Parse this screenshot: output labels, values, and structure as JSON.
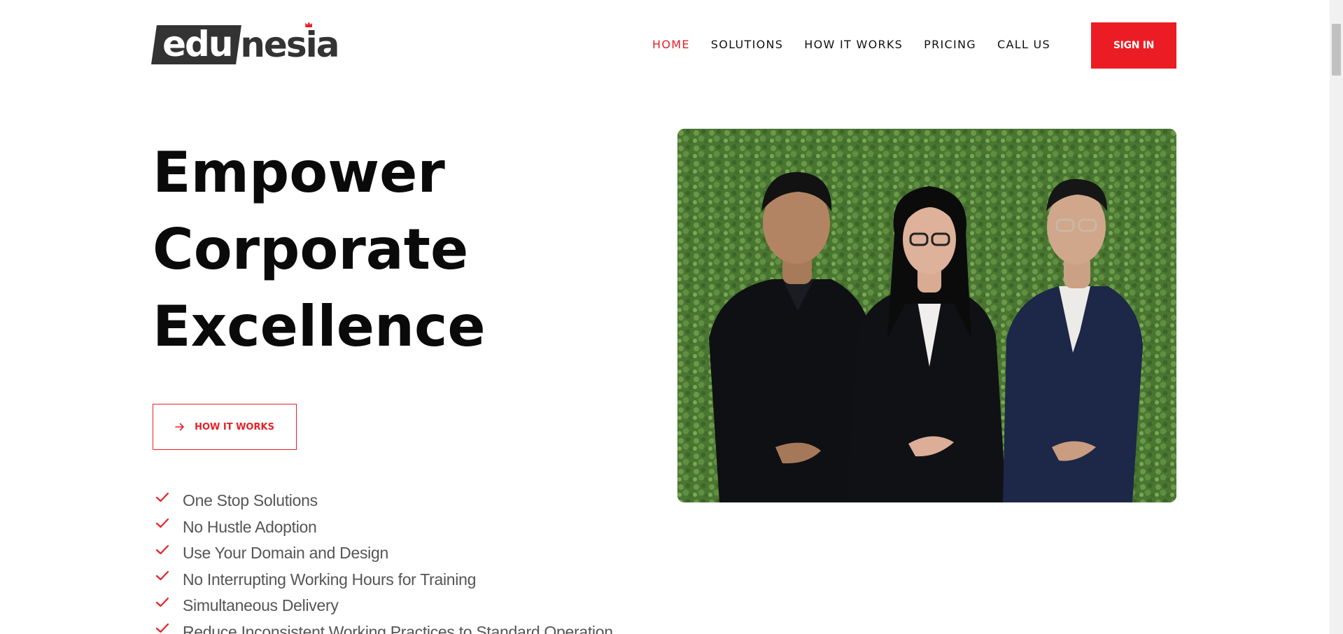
{
  "brand": {
    "logo_boxed": "edu",
    "logo_rest": "nesia",
    "accent_color": "#e62129"
  },
  "nav": {
    "items": [
      {
        "label": "HOME",
        "active": true
      },
      {
        "label": "SOLUTIONS",
        "active": false
      },
      {
        "label": "HOW IT WORKS",
        "active": false
      },
      {
        "label": "PRICING",
        "active": false
      },
      {
        "label": "CALL US",
        "active": false
      }
    ],
    "sign_in_label": "SIGN IN"
  },
  "hero": {
    "title_lines": [
      "Empower",
      "Corporate",
      "Excellence"
    ],
    "button_label": "HOW IT WORKS",
    "button_icon": "arrow-right-icon",
    "features": [
      "One Stop Solutions",
      "No Hustle Adoption",
      "Use Your Domain and Design",
      "No Interrupting Working Hours for Training",
      "Simultaneous Delivery",
      "Reduce Inconsistent Working Practices to Standard Operation"
    ],
    "feature_icon": "check-icon"
  }
}
